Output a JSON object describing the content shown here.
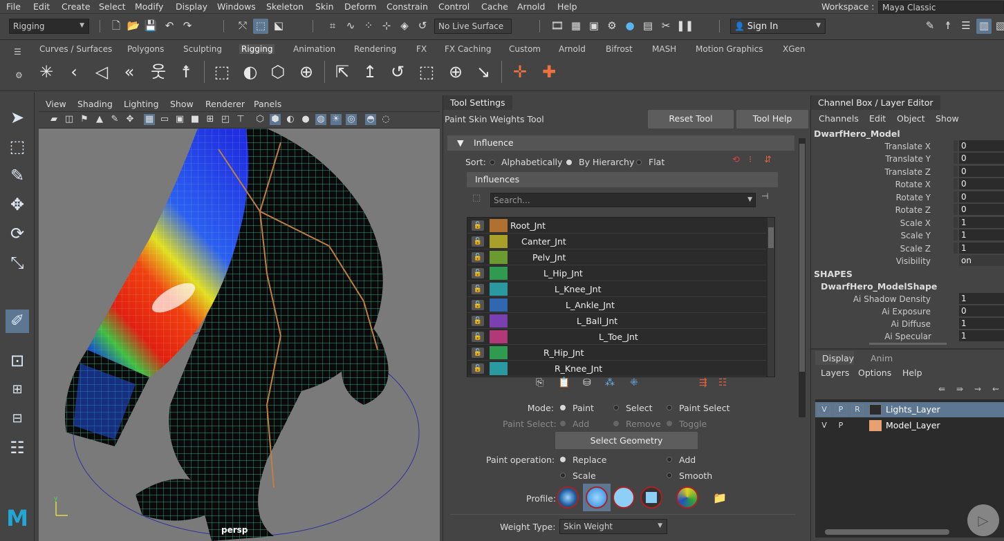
{
  "menubar": {
    "items": [
      "File",
      "Edit",
      "Create",
      "Select",
      "Modify",
      "Display",
      "Windows",
      "Skeleton",
      "Skin",
      "Deform",
      "Constrain",
      "Control",
      "Cache",
      "Arnold",
      "Help"
    ],
    "workspace_label": "Workspace :",
    "workspace_value": "Maya Classic"
  },
  "statusline": {
    "mode": "Rigging",
    "live_surface": "No Live Surface",
    "sign_in": "Sign In"
  },
  "shelf": {
    "tabs": [
      "Curves / Surfaces",
      "Polygons",
      "Sculpting",
      "Rigging",
      "Animation",
      "Rendering",
      "FX",
      "FX Caching",
      "Custom",
      "Arnold",
      "Bifrost",
      "MASH",
      "Motion Graphics",
      "XGen"
    ],
    "active_tab": "Rigging"
  },
  "viewport": {
    "menus": [
      "View",
      "Shading",
      "Lighting",
      "Show",
      "Renderer",
      "Panels"
    ],
    "camera_label": "persp"
  },
  "tool_settings": {
    "title": "Tool Settings",
    "tool_name": "Paint Skin Weights Tool",
    "reset_button": "Reset Tool",
    "help_button": "Tool Help",
    "influence_section": "Influence",
    "sort_label": "Sort:",
    "sort_options": [
      "Alphabetically",
      "By Hierarchy",
      "Flat"
    ],
    "sort_selected": "By Hierarchy",
    "influences_header": "Influences",
    "search_placeholder": "Search...",
    "joints": [
      {
        "name": "Root_Jnt",
        "color": "#b07030"
      },
      {
        "name": "Canter_Jnt",
        "color": "#a8a028"
      },
      {
        "name": "Pelv_Jnt",
        "color": "#6a9a30"
      },
      {
        "name": "L_Hip_Jnt",
        "color": "#2f9a50"
      },
      {
        "name": "L_Knee_Jnt",
        "color": "#2a9aa0"
      },
      {
        "name": "L_Ankle_Jnt",
        "color": "#2f68b0"
      },
      {
        "name": "L_Ball_Jnt",
        "color": "#7a40b0"
      },
      {
        "name": "L_Toe_Jnt",
        "color": "#b03a78"
      },
      {
        "name": "R_Hip_Jnt",
        "color": "#2f9a50"
      },
      {
        "name": "R_Knee_Jnt",
        "color": "#2a9aa0"
      }
    ],
    "mode_label": "Mode:",
    "mode_options": [
      "Paint",
      "Select",
      "Paint Select"
    ],
    "mode_selected": "Paint",
    "paint_select_label": "Paint Select:",
    "paint_select_options": [
      "Add",
      "Remove",
      "Toggle"
    ],
    "select_geometry_button": "Select Geometry",
    "paint_operation_label": "Paint operation:",
    "paint_operation_options": [
      "Replace",
      "Add",
      "Scale",
      "Smooth"
    ],
    "paint_operation_selected": "Replace",
    "profile_label": "Profile:",
    "weight_type_label": "Weight Type:",
    "weight_type_value": "Skin Weight"
  },
  "channel_box": {
    "title": "Channel Box / Layer Editor",
    "menus": [
      "Channels",
      "Edit",
      "Object",
      "Show"
    ],
    "object_name": "DwarfHero_Model",
    "attributes": [
      {
        "label": "Translate X",
        "value": "0"
      },
      {
        "label": "Translate Y",
        "value": "0"
      },
      {
        "label": "Translate Z",
        "value": "0"
      },
      {
        "label": "Rotate X",
        "value": "0"
      },
      {
        "label": "Rotate Y",
        "value": "0"
      },
      {
        "label": "Rotate Z",
        "value": "0"
      },
      {
        "label": "Scale X",
        "value": "1"
      },
      {
        "label": "Scale Y",
        "value": "1"
      },
      {
        "label": "Scale Z",
        "value": "1"
      },
      {
        "label": "Visibility",
        "value": "on"
      }
    ],
    "shapes_label": "SHAPES",
    "shape_name": "DwarfHero_ModelShape",
    "shape_attributes": [
      {
        "label": "Ai Shadow Density",
        "value": "1"
      },
      {
        "label": "Ai Exposure",
        "value": "0"
      },
      {
        "label": "Ai Diffuse",
        "value": "1"
      },
      {
        "label": "Ai Specular",
        "value": "1"
      }
    ]
  },
  "layer_editor": {
    "tabs": [
      "Display",
      "Anim"
    ],
    "active_tab": "Display",
    "menus": [
      "Layers",
      "Options",
      "Help"
    ],
    "layers": [
      {
        "v": "V",
        "p": "P",
        "r": "R",
        "name": "Lights_Layer",
        "color": "#2b2b2b",
        "selected": true
      },
      {
        "v": "V",
        "p": "P",
        "r": "",
        "name": "Model_Layer",
        "color": "#e8a070",
        "selected": false
      }
    ]
  }
}
